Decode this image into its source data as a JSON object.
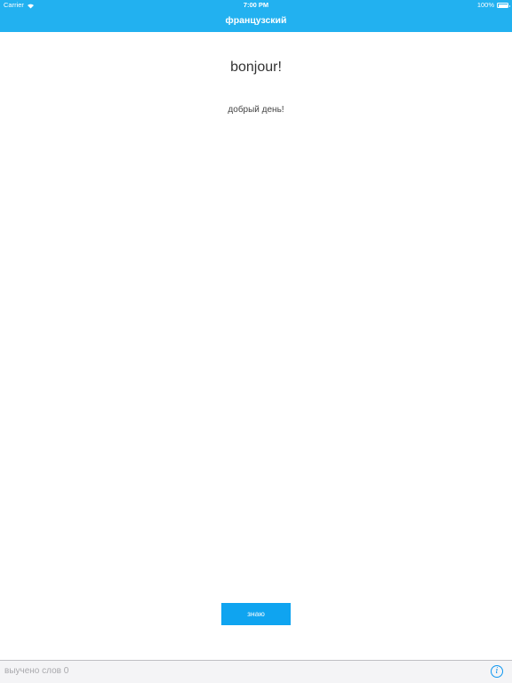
{
  "status_bar": {
    "carrier": "Carrier",
    "time": "7:00 PM",
    "battery": "100%",
    "wifi_icon": "wifi-icon",
    "battery_icon": "battery-icon"
  },
  "nav": {
    "title": "французский"
  },
  "card": {
    "word": "bonjour!",
    "translation": "добрый день!"
  },
  "actions": {
    "know_label": "знаю"
  },
  "footer": {
    "learned_label": "выучено слов 0",
    "info_icon_glyph": "i",
    "info_icon": "info-icon"
  },
  "colors": {
    "header": "#22b1f0",
    "button": "#0fa4f0",
    "info_icon": "#0c96f0",
    "footer_bg": "#f4f4f6"
  }
}
